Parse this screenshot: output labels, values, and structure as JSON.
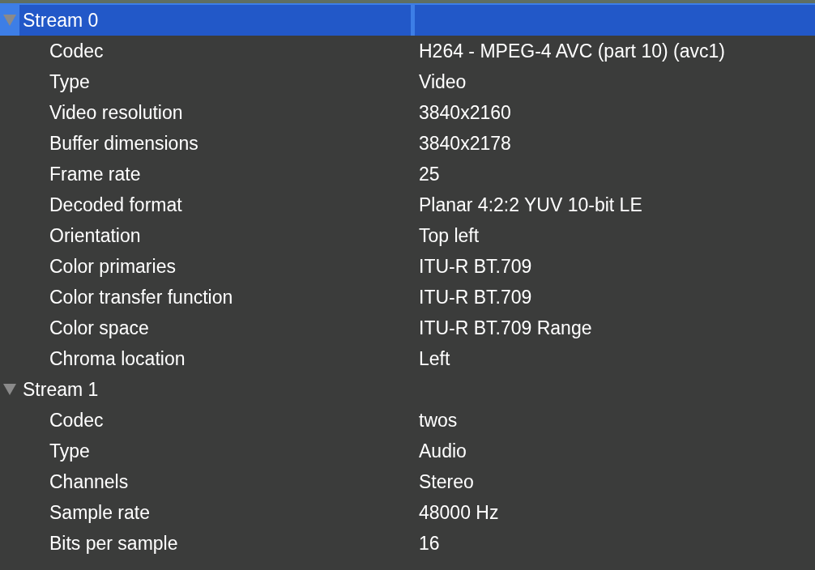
{
  "streams": [
    {
      "title": "Stream 0",
      "expanded": true,
      "selected": true,
      "children": [
        {
          "name": "Codec",
          "value": "H264 - MPEG-4 AVC (part 10) (avc1)"
        },
        {
          "name": "Type",
          "value": "Video"
        },
        {
          "name": "Video resolution",
          "value": "3840x2160"
        },
        {
          "name": "Buffer dimensions",
          "value": "3840x2178"
        },
        {
          "name": "Frame rate",
          "value": "25"
        },
        {
          "name": "Decoded format",
          "value": "Planar 4:2:2 YUV 10-bit LE"
        },
        {
          "name": "Orientation",
          "value": "Top left"
        },
        {
          "name": "Color primaries",
          "value": "ITU-R BT.709"
        },
        {
          "name": "Color transfer function",
          "value": "ITU-R BT.709"
        },
        {
          "name": "Color space",
          "value": "ITU-R BT.709 Range"
        },
        {
          "name": "Chroma location",
          "value": "Left"
        }
      ]
    },
    {
      "title": "Stream 1",
      "expanded": true,
      "selected": false,
      "children": [
        {
          "name": "Codec",
          "value": "twos"
        },
        {
          "name": "Type",
          "value": "Audio"
        },
        {
          "name": "Channels",
          "value": "Stereo"
        },
        {
          "name": "Sample rate",
          "value": "48000 Hz"
        },
        {
          "name": "Bits per sample",
          "value": "16"
        }
      ]
    }
  ]
}
